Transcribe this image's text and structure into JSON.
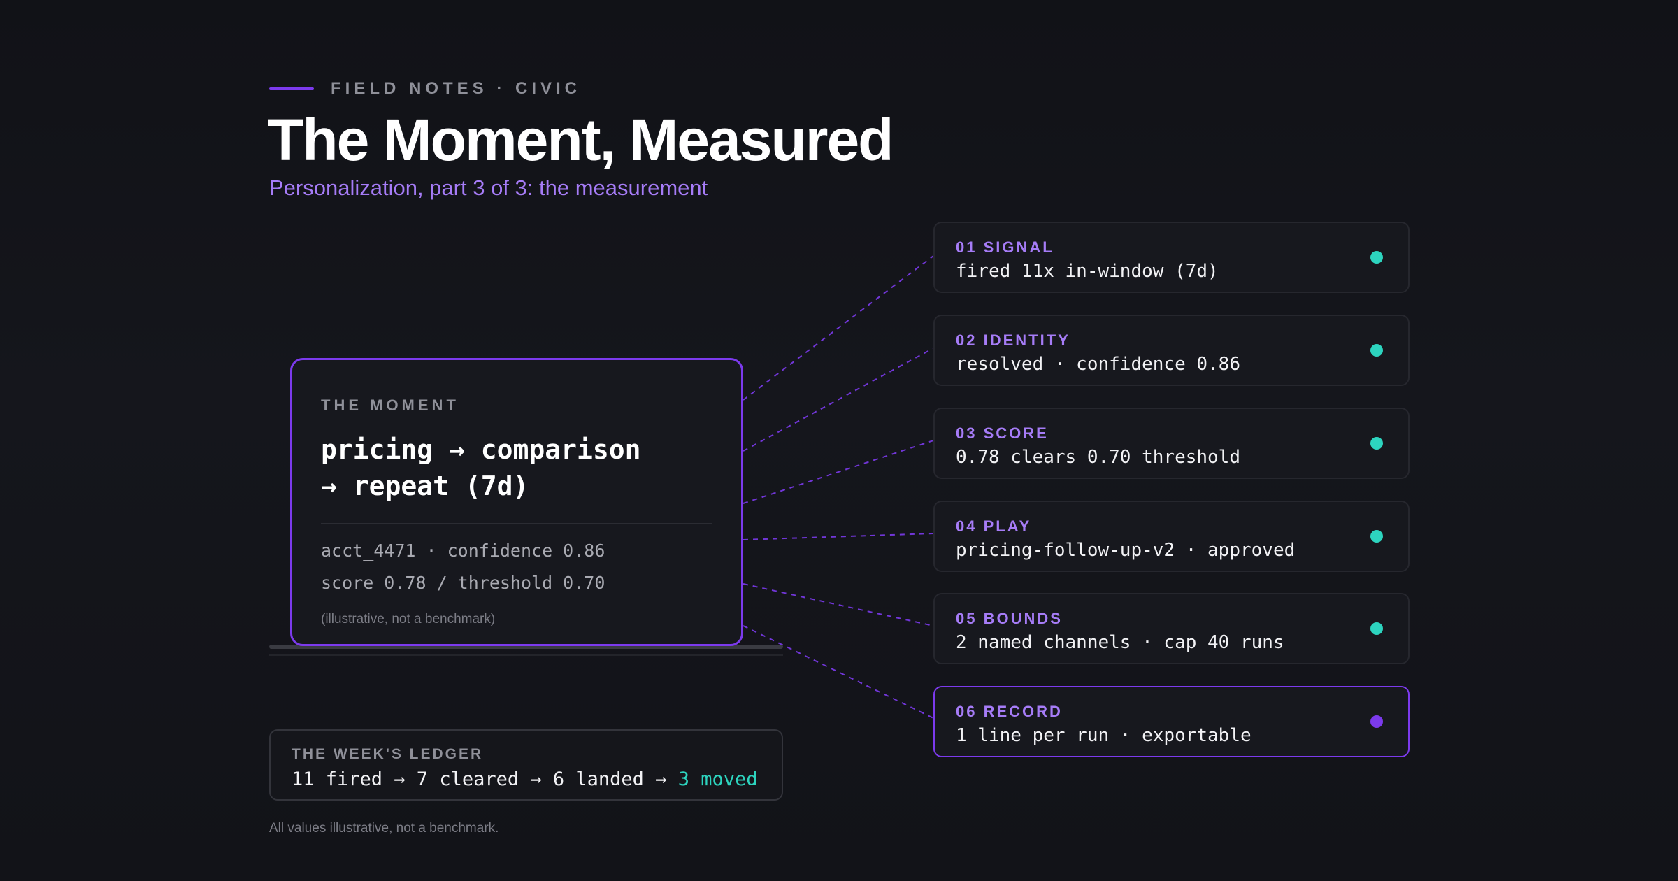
{
  "header": {
    "eyebrow": "FIELD NOTES · CIVIC",
    "title": "The Moment, Measured",
    "subtitle": "Personalization, part 3 of 3: the measurement"
  },
  "moment": {
    "label": "THE MOMENT",
    "headline_line1": "pricing → comparison",
    "headline_line2": "→ repeat (7d)",
    "meta_line1": "acct_4471 · confidence 0.86",
    "meta_line2": "score 0.78 / threshold 0.70",
    "note": "(illustrative, not a benchmark)"
  },
  "steps": [
    {
      "label": "01 SIGNAL",
      "value": "fired 11x in-window (7d)",
      "status": "teal"
    },
    {
      "label": "02 IDENTITY",
      "value": "resolved · confidence 0.86",
      "status": "teal"
    },
    {
      "label": "03 SCORE",
      "value": "0.78 clears 0.70 threshold",
      "status": "teal"
    },
    {
      "label": "04 PLAY",
      "value": "pricing-follow-up-v2 · approved",
      "status": "teal"
    },
    {
      "label": "05 BOUNDS",
      "value": "2 named channels · cap 40 runs",
      "status": "teal"
    },
    {
      "label": "06 RECORD",
      "value": "1 line per run · exportable",
      "status": "purple"
    }
  ],
  "ledger": {
    "label": "THE WEEK'S LEDGER",
    "flow": "11 fired → 7 cleared → 6 landed → ",
    "accent": "3 moved"
  },
  "footnote": "All values illustrative, not a benchmark.",
  "colors": {
    "accent_purple": "#7c3aed",
    "label_purple": "#a67cf7",
    "teal": "#2dd4bf",
    "background": "#131419"
  }
}
